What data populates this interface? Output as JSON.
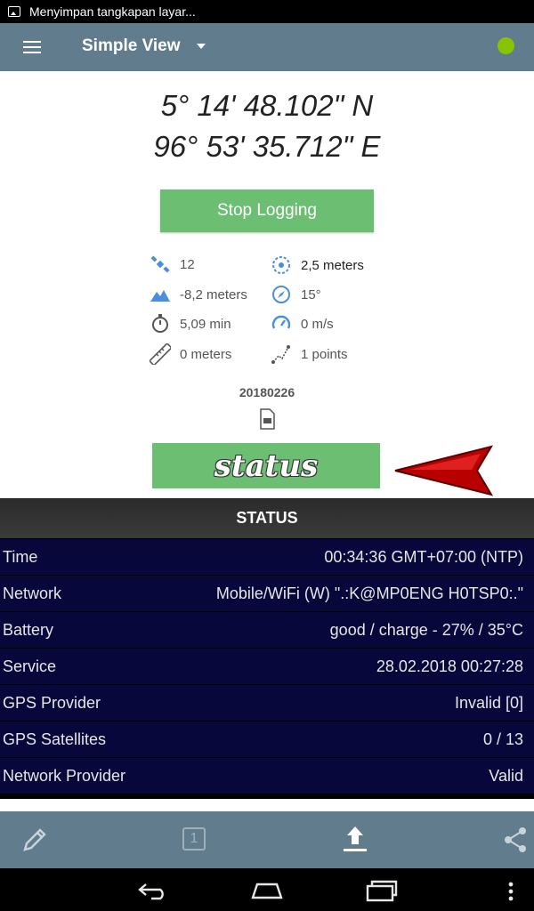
{
  "status_bar": {
    "notification": "Menyimpan tangkapan layar..."
  },
  "app_bar": {
    "title": "Simple View",
    "menu_icon": "hamburger-menu-icon",
    "gps_indicator_color": "#8ac300"
  },
  "coordinates": {
    "latitude": "5° 14' 48.102\" N",
    "longitude": "96° 53' 35.712\" E"
  },
  "logging_button": {
    "label": "Stop Logging",
    "color": "#6cbf72"
  },
  "stats": {
    "satellites": "12",
    "accuracy": "2,5 meters",
    "altitude": "-8,2 meters",
    "bearing": "15°",
    "duration": "5,09 min",
    "speed": "0 m/s",
    "distance": "0 meters",
    "points": "1 points"
  },
  "file": {
    "name": "20180226"
  },
  "annotation": {
    "text": "status",
    "arrow_color": "#c00000"
  },
  "status_panel": {
    "title": "STATUS",
    "rows": [
      {
        "label": "Time",
        "value": "00:34:36 GMT+07:00 (NTP)"
      },
      {
        "label": "Network",
        "value": "Mobile/WiFi (W) \".:K@MP0ENG H0TSP0:.\""
      },
      {
        "label": "Battery",
        "value": "good / charge - 27% / 35°C"
      },
      {
        "label": "Service",
        "value": "28.02.2018 00:27:28"
      },
      {
        "label": "GPS Provider",
        "value": "Invalid [0]"
      },
      {
        "label": "GPS Satellites",
        "value": "0 / 13"
      },
      {
        "label": "Network Provider",
        "value": "Valid"
      }
    ]
  },
  "toolbar": {
    "page_number": "1"
  }
}
